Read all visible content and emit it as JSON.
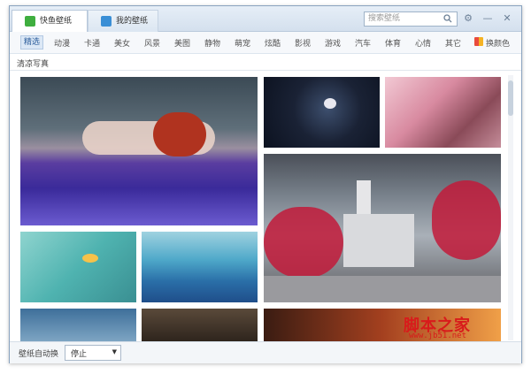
{
  "tabs": [
    {
      "label": "快鱼壁纸",
      "icon": "wallpaper-icon",
      "color": "#3fae3f"
    },
    {
      "label": "我的壁纸",
      "icon": "my-wallpaper-icon",
      "color": "#3a8fd6"
    }
  ],
  "search": {
    "placeholder": "搜索壁纸",
    "icon": "search-icon"
  },
  "window_buttons": {
    "settings": "gear-icon",
    "minimize": "minimize-icon",
    "close": "close-icon"
  },
  "categories": [
    "精选",
    "动漫",
    "卡通",
    "美女",
    "风景",
    "美图",
    "静物",
    "萌宠",
    "炫酷",
    "影视",
    "游戏",
    "汽车",
    "体育",
    "心情",
    "其它"
  ],
  "selected_category": "精选",
  "skin": {
    "label": "换颜色",
    "icon": "palette-icon"
  },
  "subtitle": "清凉写真",
  "bottom": {
    "auto_change_label": "壁纸自动换",
    "select_value": "停止",
    "select_icon": "dropdown-arrow-icon"
  },
  "watermark": {
    "line1": "脚本之家",
    "line2": "www.jb51.net"
  },
  "colors": {
    "accent": "#2a5b9a",
    "tab_bg": "#d4e0ee",
    "watermark": "#d81b1b"
  }
}
